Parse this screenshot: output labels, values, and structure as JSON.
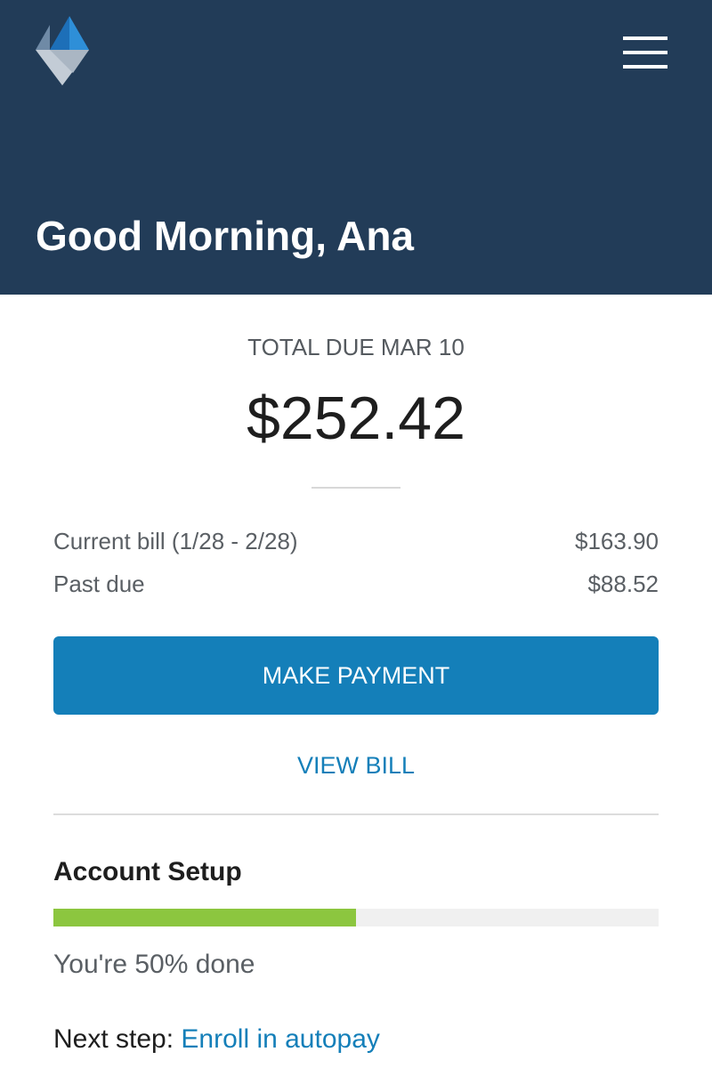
{
  "header": {
    "greeting": "Good Morning, Ana",
    "logo_icon": "diamond-logo-icon",
    "menu_icon": "hamburger-menu-icon",
    "background_color": "#223c58"
  },
  "bill": {
    "due_label": "TOTAL DUE MAR 10",
    "total_amount": "$252.42",
    "line_items": [
      {
        "label": "Current bill (1/28 - 2/28)",
        "value": "$163.90"
      },
      {
        "label": "Past due",
        "value": "$88.52"
      }
    ],
    "make_payment_label": "MAKE PAYMENT",
    "view_bill_label": "VIEW BILL"
  },
  "account_setup": {
    "title": "Account Setup",
    "progress_percent": 50,
    "progress_text": "You're 50% done",
    "next_step_prefix": "Next step:",
    "next_step_link": "Enroll in autopay"
  },
  "colors": {
    "accent": "#147fb9",
    "progress": "#8cc63f"
  }
}
